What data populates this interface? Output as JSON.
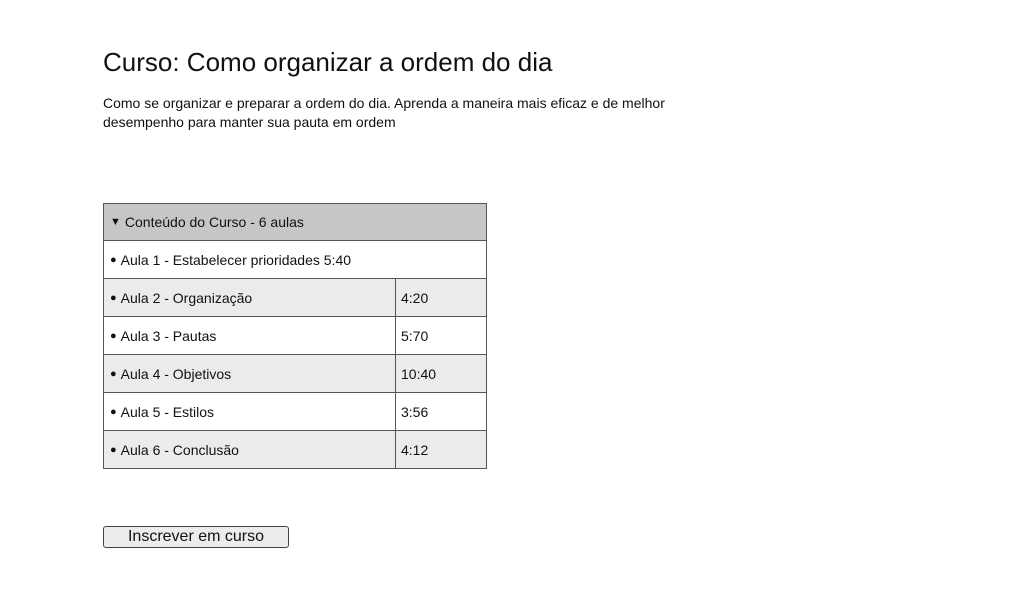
{
  "course": {
    "title": "Curso: Como organizar a ordem do dia",
    "description": "Como se organizar e preparar a ordem do dia. Aprenda a maneira mais eficaz e de melhor desempenho para manter sua pauta em ordem"
  },
  "content_table": {
    "header_icon": "triangle-down-icon",
    "header_label": "Conteúdo do Curso - 6 aulas",
    "lessons": [
      {
        "bullet": "●",
        "label": "Aula 1 - Estabelecer prioridades 5:40",
        "time": ""
      },
      {
        "bullet": "●",
        "label": "Aula 2 - Organização",
        "time": "4:20"
      },
      {
        "bullet": "●",
        "label": "Aula 3 - Pautas",
        "time": "5:70"
      },
      {
        "bullet": "●",
        "label": "Aula 4 - Objetivos",
        "time": "10:40"
      },
      {
        "bullet": "●",
        "label": "Aula 5 - Estilos",
        "time": "3:56"
      },
      {
        "bullet": "●",
        "label": "Aula 6 - Conclusão",
        "time": "4:12"
      }
    ]
  },
  "actions": {
    "enroll_label": "Inscrever em curso"
  }
}
